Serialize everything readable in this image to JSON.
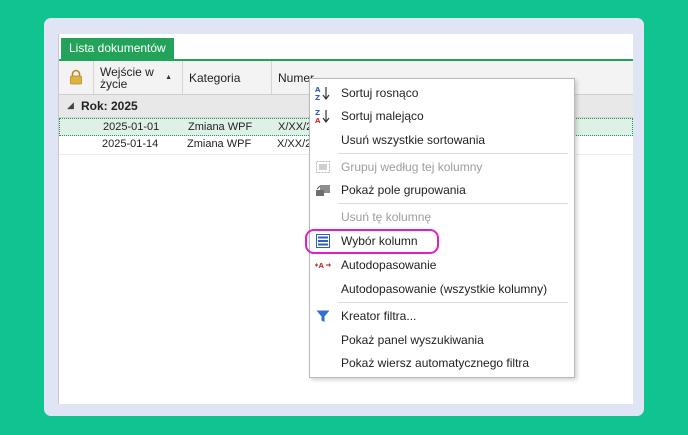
{
  "tab": {
    "label": "Lista dokumentów"
  },
  "columns": {
    "entry": "Wejście w życie",
    "category": "Kategoria",
    "number": "Numer"
  },
  "group": {
    "label": "Rok: 2025"
  },
  "rows": [
    {
      "date": "2025-01-01",
      "category": "Zmiana WPF",
      "number": "X/XX/2("
    },
    {
      "date": "2025-01-14",
      "category": "Zmiana WPF",
      "number": "X/XX/2("
    }
  ],
  "menu": {
    "sort_asc": "Sortuj rosnąco",
    "sort_desc": "Sortuj malejąco",
    "clear_sort": "Usuń wszystkie sortowania",
    "group_by": "Grupuj według tej kolumny",
    "show_group_panel": "Pokaż pole grupowania",
    "remove_column": "Usuń tę kolumnę",
    "column_chooser": "Wybór kolumn",
    "autofit": "Autodopasowanie",
    "autofit_all": "Autodopasowanie (wszystkie kolumny)",
    "filter_editor": "Kreator filtra...",
    "show_find_panel": "Pokaż panel wyszukiwania",
    "show_auto_filter_row": "Pokaż wiersz automatycznego filtra"
  },
  "colors": {
    "accent": "#23a35a",
    "highlight": "#e21ec4",
    "background": "#0fc48f"
  }
}
